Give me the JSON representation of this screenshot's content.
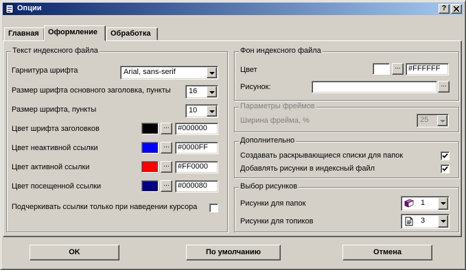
{
  "window": {
    "title": "Опции",
    "help_label": "?",
    "close_label": "✕"
  },
  "tabs": [
    {
      "label": "Главная",
      "active": false
    },
    {
      "label": "Оформление",
      "active": true
    },
    {
      "label": "Обработка",
      "active": false
    }
  ],
  "index_text": {
    "group_title": "Текст индексного файла",
    "font_family": {
      "label": "Гарнитура шрифта",
      "value": "Arial, sans-serif"
    },
    "header_size": {
      "label": "Размер шрифта основного заголовка, пункты",
      "value": "16"
    },
    "font_size": {
      "label": "Размер шрифта, пункты",
      "value": "10"
    },
    "heading_color": {
      "label": "Цвет шрифта заголовков",
      "value": "#000000",
      "swatch": "#000000"
    },
    "inactive_link_color": {
      "label": "Цвет неактивной ссылки",
      "value": "#0000FF",
      "swatch": "#0000FF"
    },
    "active_link_color": {
      "label": "Цвет активной ссылки",
      "value": "#FF0000",
      "swatch": "#FF0000"
    },
    "visited_link_color": {
      "label": "Цвет посещенной ссылки",
      "value": "#000080",
      "swatch": "#000080"
    },
    "underline_hover": {
      "label": "Подчеркивать ссылки только при наведении курсора",
      "checked": false
    },
    "dots_label": "..."
  },
  "background": {
    "group_title": "Фон индексного файла",
    "color": {
      "label": "Цвет",
      "value": "#FFFFFF",
      "swatch": "#FFFFFF"
    },
    "image": {
      "label": "Рисунок:",
      "value": ""
    },
    "dots_label": "..."
  },
  "frames": {
    "group_title": "Параметры фреймов",
    "width": {
      "label": "Ширина фрейма, %",
      "value": "25"
    }
  },
  "additional": {
    "group_title": "Дополнительно",
    "dropdown_lists": {
      "label": "Создавать раскрывающиеся списки для папок",
      "checked": true
    },
    "add_images": {
      "label": "Добавлять рисунки в индексный файл",
      "checked": true
    }
  },
  "images": {
    "group_title": "Выбор рисунков",
    "folder_images": {
      "label": "Рисунки для папок",
      "value": "1",
      "icon": "book-icon"
    },
    "topic_images": {
      "label": "Рисунки для топиков",
      "value": "3",
      "icon": "document-icon"
    }
  },
  "buttons": {
    "ok": "OK",
    "default": "По умолчанию",
    "cancel": "Отмена"
  },
  "colors": {
    "titlebar_start": "#0a246a",
    "titlebar_end": "#a6caf0",
    "face": "#d4d0c8"
  }
}
